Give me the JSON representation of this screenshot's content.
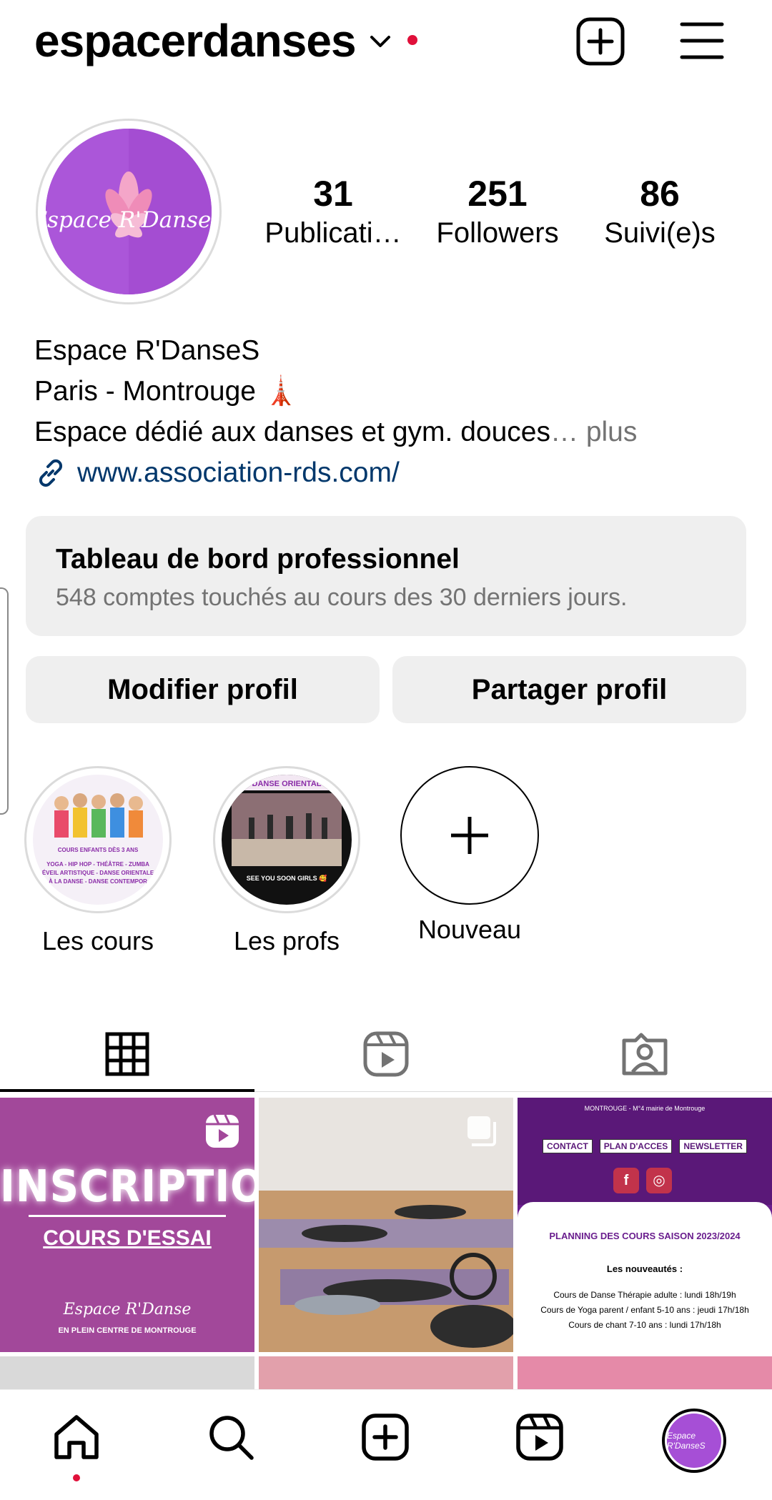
{
  "header": {
    "username": "espacerdanses"
  },
  "profile": {
    "avatar_text": "Espace R'DanseS",
    "stats": [
      {
        "value": "31",
        "label": "Publicati…"
      },
      {
        "value": "251",
        "label": "Followers"
      },
      {
        "value": "86",
        "label": "Suivi(e)s"
      }
    ],
    "bio": {
      "name": "Espace R'DanseS",
      "location": "Paris - Montrouge 🗼",
      "description": "Espace dédié aux danses et gym. douces",
      "ellipsis": "… ",
      "more": "plus",
      "link": "www.association-rds.com/"
    }
  },
  "dashboard": {
    "title": "Tableau de bord professionnel",
    "subtitle": "548 comptes touchés au cours des 30 derniers jours."
  },
  "buttons": {
    "edit": "Modifier profil",
    "share": "Partager profil"
  },
  "highlights": [
    {
      "label": "Les cours"
    },
    {
      "label": "Les profs"
    },
    {
      "label": "Nouveau"
    }
  ],
  "highlight_art": {
    "cours_caption": "COURS ENFANTS DÈS 3 ANS",
    "cours_lines": [
      "YOGA - HIP HOP - THÉÂTRE - ZUMBA",
      "ÉVEIL ARTISTIQUE - DANSE ORIENTALE",
      "À LA DANSE - DANSE CONTEMPOR"
    ],
    "profs_top": "DANSE ORIENTAL",
    "profs_caption": "SEE YOU SOON GIRLS 🥰"
  },
  "posts": {
    "inscription": {
      "title": "INSCRIPTION",
      "subtitle": "COURS D'ESSAI",
      "logo": "Espace R'Danse",
      "footer": "EN PLEIN CENTRE DE MONTROUGE"
    },
    "planning": {
      "top": "MONTROUGE - M°4 mairie de Montrouge",
      "navs": [
        "CONTACT",
        "PLAN D'ACCES",
        "NEWSLETTER"
      ],
      "title": "PLANNING DES COURS SAISON 2023/2024",
      "new_heading": "Les nouveautés :",
      "lines": [
        "Cours de Danse Thérapie adulte : lundi 18h/19h",
        "Cours de Yoga parent / enfant 5-10 ans : jeudi 17h/18h",
        "Cours de chant 7-10 ans : lundi 17h/18h"
      ]
    }
  },
  "bottom_nav": {
    "profile_avatar": "Espace R'DanseS"
  },
  "colors": {
    "brand_purple": "#a64fd6",
    "link": "#00376b",
    "notification": "#e0103a",
    "muted": "#737373",
    "panel": "#efefef"
  }
}
